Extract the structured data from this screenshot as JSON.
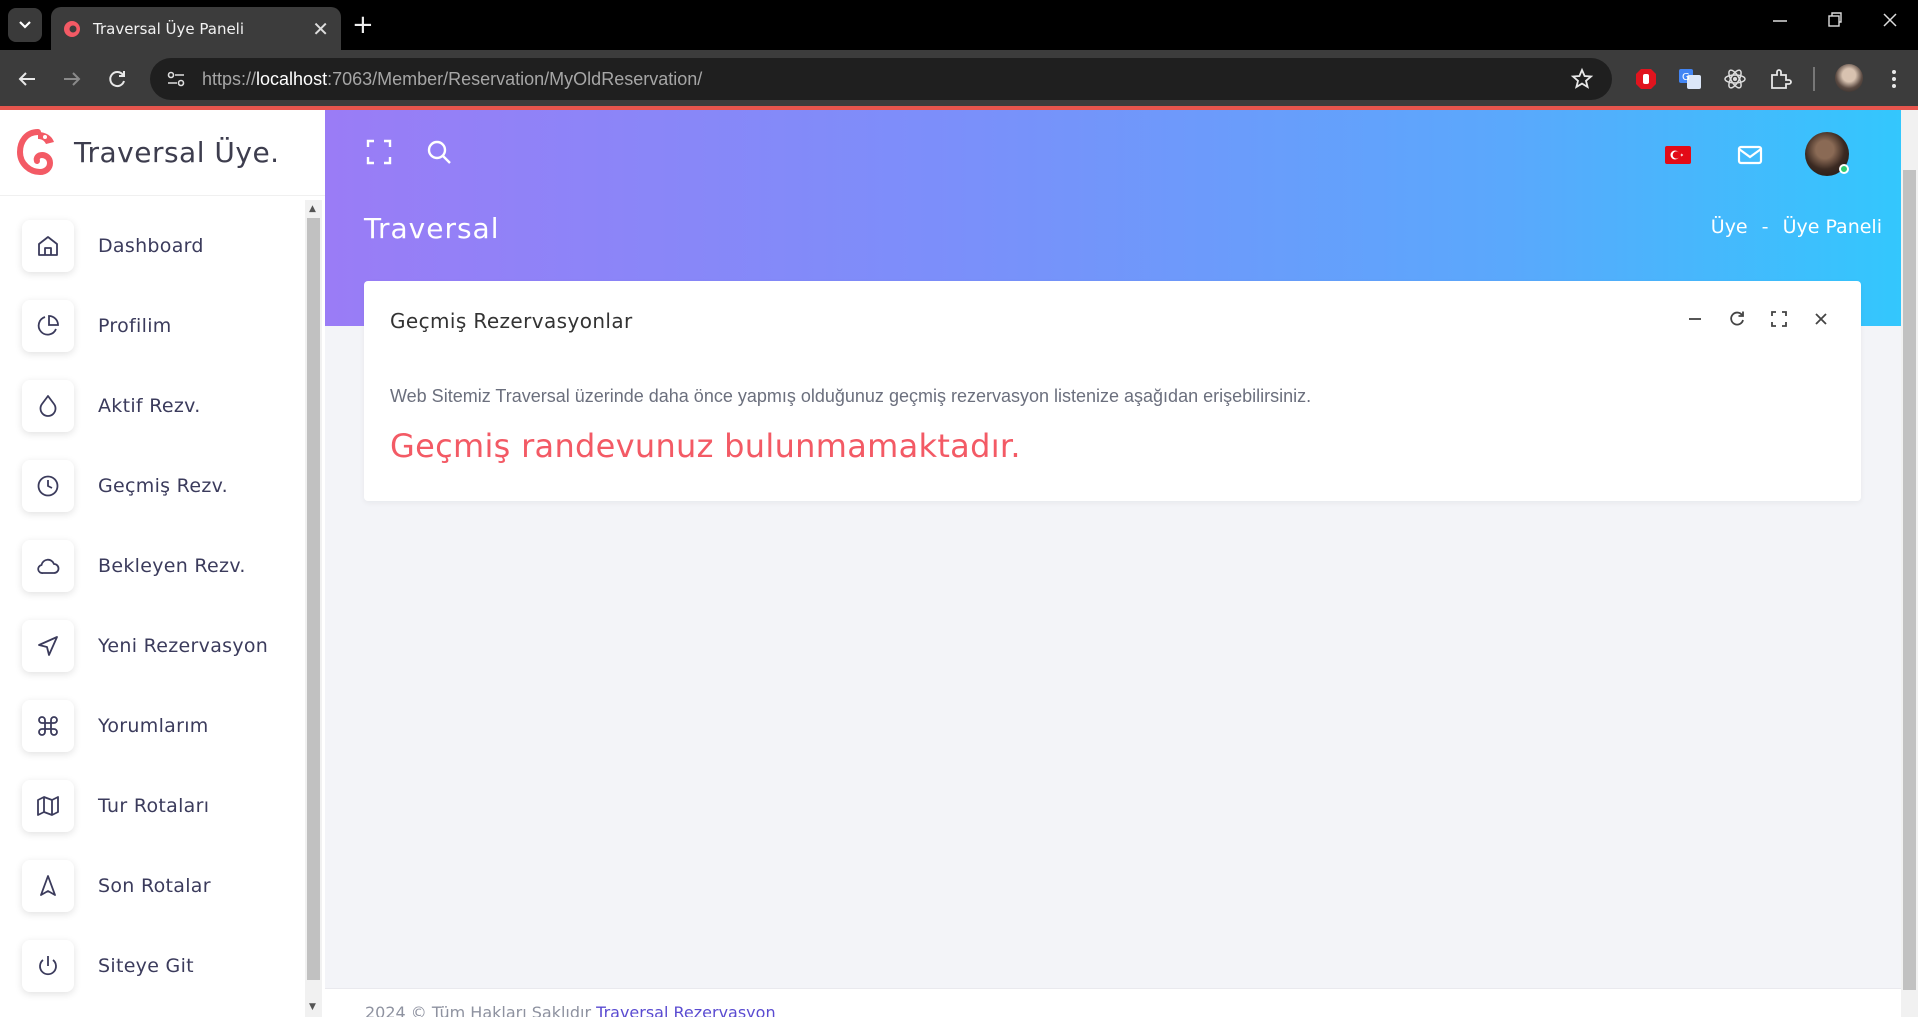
{
  "browser": {
    "tab_title": "Traversal Üye Paneli",
    "tab_close": "✕",
    "new_tab": "+",
    "url_prefix": "https://",
    "url_host": "localhost",
    "url_rest": ":7063/Member/Reservation/MyOldReservation/"
  },
  "sidebar": {
    "logo_text": "Traversal Üye.",
    "items": [
      {
        "label": "Dashboard",
        "icon": "home-icon"
      },
      {
        "label": "Profilim",
        "icon": "pie-chart-icon"
      },
      {
        "label": "Aktif Rezv.",
        "icon": "droplet-icon"
      },
      {
        "label": "Geçmiş Rezv.",
        "icon": "clock-icon"
      },
      {
        "label": "Bekleyen Rezv.",
        "icon": "cloud-icon"
      },
      {
        "label": "Yeni Rezervasyon",
        "icon": "navigation-icon"
      },
      {
        "label": "Yorumlarım",
        "icon": "command-icon"
      },
      {
        "label": "Tur Rotaları",
        "icon": "map-icon"
      },
      {
        "label": "Son Rotalar",
        "icon": "navigation-alt-icon"
      },
      {
        "label": "Siteye Git",
        "icon": "power-icon"
      }
    ]
  },
  "header": {
    "page_title": "Traversal",
    "breadcrumb_1": "Üye",
    "breadcrumb_sep": "-",
    "breadcrumb_2": "Üye Paneli"
  },
  "card": {
    "title": "Geçmiş Rezervasyonlar",
    "description": "Web Sitemiz Traversal üzerinde daha önce yapmış olduğunuz geçmiş rezervasyon listenize aşağıdan erişebilirsiniz.",
    "message": "Geçmiş randevunuz bulunmamaktadır."
  },
  "footer": {
    "text": "2024 © Tüm Hakları Saklıdır",
    "link": "Traversal Rezervasyon"
  },
  "colors": {
    "accent_red": "#f35a65",
    "header_gradient_start": "#9a7cf6",
    "header_gradient_end": "#33c7fd"
  }
}
